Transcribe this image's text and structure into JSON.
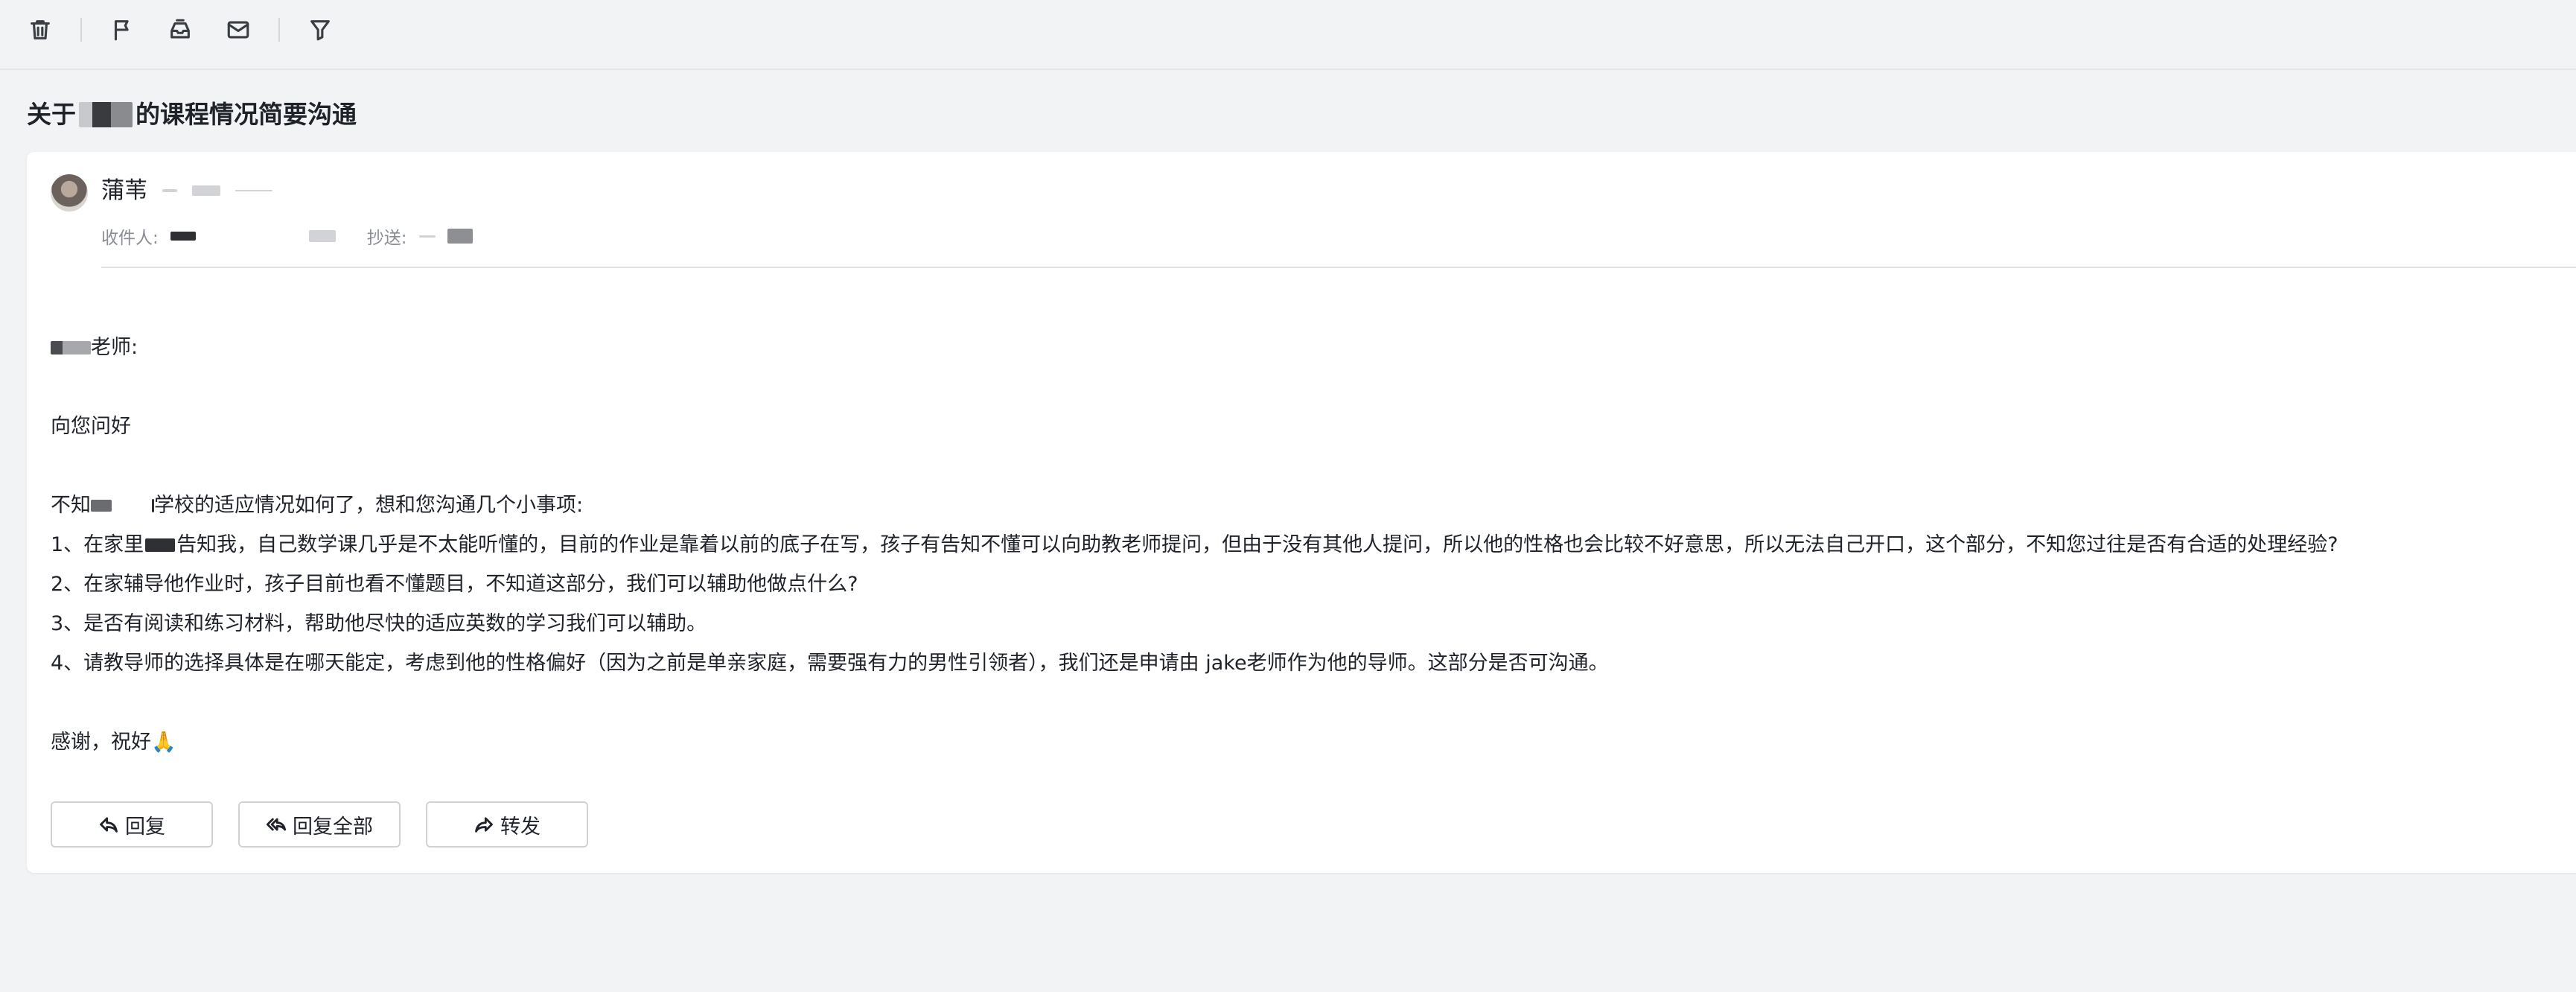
{
  "toolbar": {
    "icons": [
      "trash-icon",
      "flag-icon",
      "archive-icon",
      "mail-icon",
      "filter-icon"
    ]
  },
  "subject": {
    "prefix": "关于",
    "suffix": "的课程情况简要沟通"
  },
  "sender": {
    "name": "蒲苇"
  },
  "recipients": {
    "to_label": "收件人:",
    "cc_label": "抄送:"
  },
  "body": {
    "greeting_suffix": "老师:",
    "hello": "向您问好",
    "intro_prefix": "不知",
    "intro_suffix": "学校的适应情况如何了，想和您沟通几个小事项:",
    "item1_prefix": "1、在家里",
    "item1_suffix": "告知我，自己数学课几乎是不太能听懂的，目前的作业是靠着以前的底子在写，孩子有告知不懂可以向助教老师提问，但由于没有其他人提问，所以他的性格也会比较不好意思，所以无法自己开口，这个部分，不知您过往是否有合适的处理经验?",
    "item2": "2、在家辅导他作业时，孩子目前也看不懂题目，不知道这部分，我们可以辅助他做点什么?",
    "item3": "3、是否有阅读和练习材料，帮助他尽快的适应英数的学习我们可以辅助。",
    "item4": "4、请教导师的选择具体是在哪天能定，考虑到他的性格偏好（因为之前是单亲家庭，需要强有力的男性引领者），我们还是申请由 jake老师作为他的导师。这部分是否可沟通。",
    "closing": "感谢，祝好🙏"
  },
  "actions": {
    "reply": "回复",
    "reply_all": "回复全部",
    "forward": "转发"
  }
}
